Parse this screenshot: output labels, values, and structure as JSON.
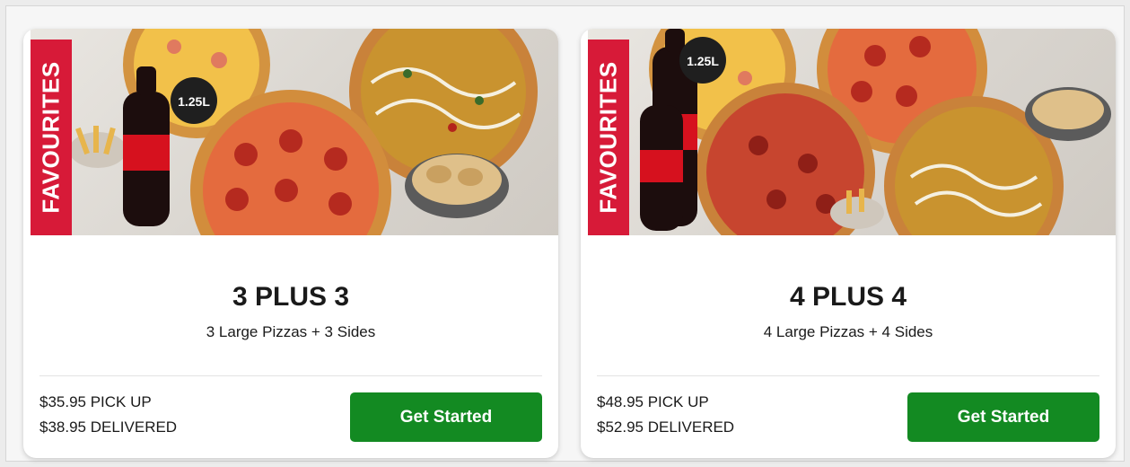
{
  "cards": [
    {
      "badge": "FAVOURITES",
      "bottle_label": "1.25L",
      "title": "3 PLUS 3",
      "subtitle": "3 Large Pizzas + 3 Sides",
      "pickup_price": "$35.95 PICK UP",
      "delivered_price": "$38.95 DELIVERED",
      "cta_label": "Get Started"
    },
    {
      "badge": "FAVOURITES",
      "bottle_label": "1.25L",
      "title": "4 PLUS 4",
      "subtitle": "4 Large Pizzas + 4 Sides",
      "pickup_price": "$48.95 PICK UP",
      "delivered_price": "$52.95 DELIVERED",
      "cta_label": "Get Started"
    }
  ],
  "colors": {
    "badge_red": "#d71a38",
    "cta_green": "#138a22"
  }
}
